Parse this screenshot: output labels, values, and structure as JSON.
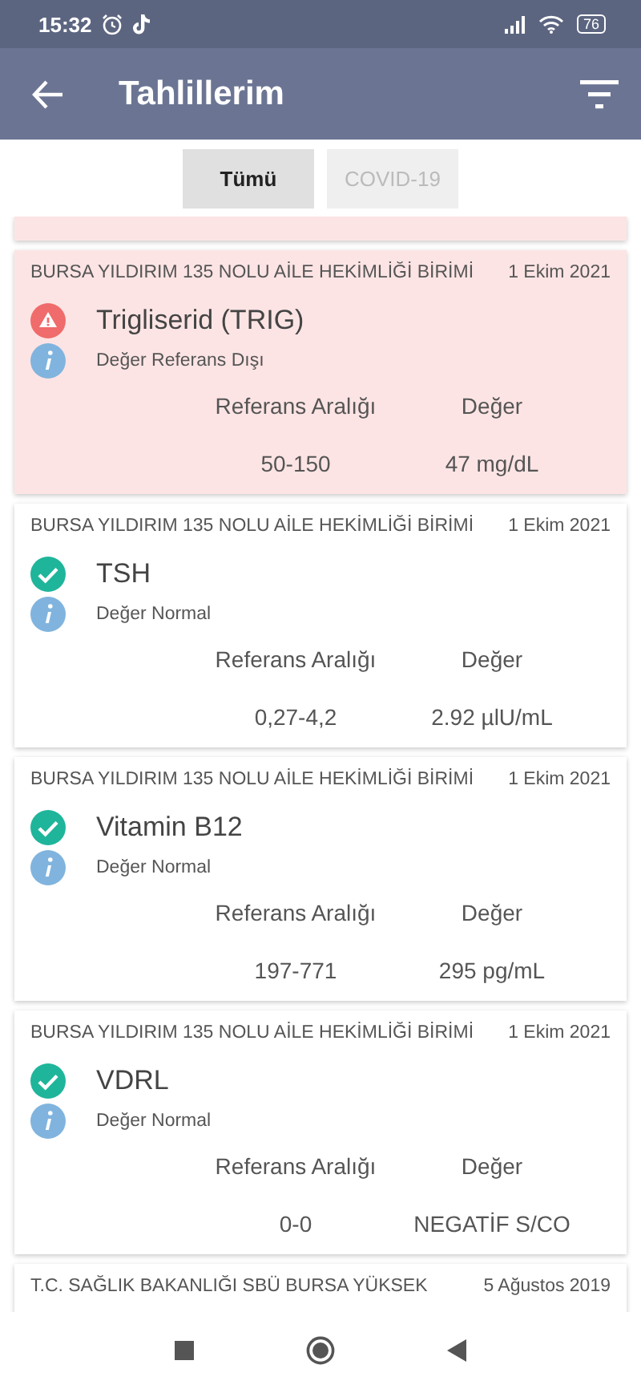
{
  "status_bar": {
    "time": "15:32",
    "battery": "76"
  },
  "app_bar": {
    "title": "Tahlillerim"
  },
  "filters": [
    {
      "label": "Tümü",
      "selected": true
    },
    {
      "label": "COVID-19",
      "selected": false
    }
  ],
  "top_partial_card": {
    "out_of_range": true
  },
  "results": [
    {
      "hospital": "BURSA YILDIRIM 135 NOLU AİLE HEKİMLİĞİ BİRİMİ",
      "date": "1 Ekim 2021",
      "out_of_range": true,
      "test": "Trigliserid (TRIG)",
      "note": "Değer Referans Dışı",
      "range_label": "Referans Aralığı",
      "value_label": "Değer",
      "range": "50-150",
      "value": "47 mg/dL"
    },
    {
      "hospital": "BURSA YILDIRIM 135 NOLU AİLE HEKİMLİĞİ BİRİMİ",
      "date": "1 Ekim 2021",
      "out_of_range": false,
      "test": "TSH",
      "note": "Değer Normal",
      "range_label": "Referans Aralığı",
      "value_label": "Değer",
      "range": "0,27-4,2",
      "value": "2.92 µlU/mL"
    },
    {
      "hospital": "BURSA YILDIRIM 135 NOLU AİLE HEKİMLİĞİ BİRİMİ",
      "date": "1 Ekim 2021",
      "out_of_range": false,
      "test": "Vitamin B12",
      "note": "Değer Normal",
      "range_label": "Referans Aralığı",
      "value_label": "Değer",
      "range": "197-771",
      "value": "295 pg/mL"
    },
    {
      "hospital": "BURSA YILDIRIM 135 NOLU AİLE HEKİMLİĞİ BİRİMİ",
      "date": "1 Ekim 2021",
      "out_of_range": false,
      "test": "VDRL",
      "note": "Değer Normal",
      "range_label": "Referans Aralığı",
      "value_label": "Değer",
      "range": "0-0",
      "value": "NEGATİF S/CO"
    },
    {
      "hospital": "T.C. SAĞLIK BAKANLIĞI SBÜ BURSA YÜKSEK",
      "date": "5 Ağustos 2019"
    }
  ]
}
